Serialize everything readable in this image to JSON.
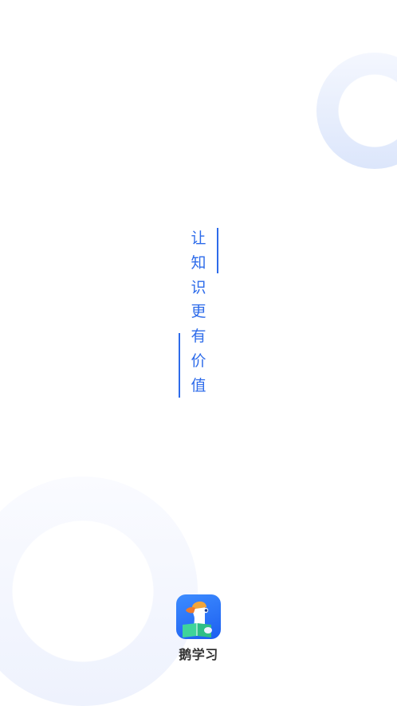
{
  "splash": {
    "slogan": [
      "让",
      "知",
      "识",
      "更",
      "有",
      "价",
      "值"
    ],
    "app_name": "鹅学习"
  },
  "colors": {
    "accent": "#2d6bea",
    "icon_background": "#1d5ff0",
    "app_name_text": "#333333",
    "ring": "#dce6fb"
  },
  "icons": {
    "app_logo": "goose-reading-book-icon"
  }
}
